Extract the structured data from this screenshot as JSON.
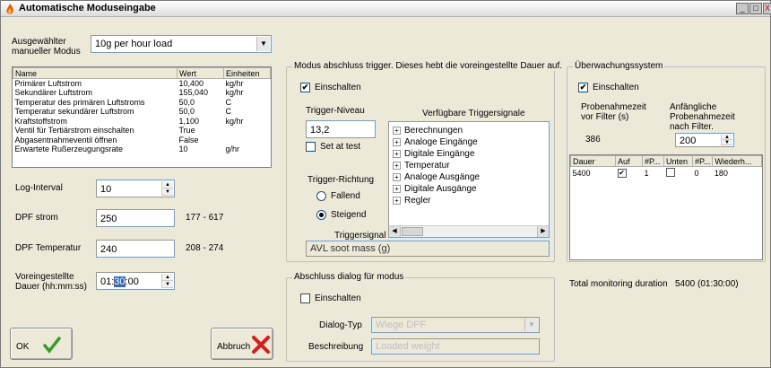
{
  "window": {
    "title": "Automatische Moduseingabe",
    "buttons": [
      "_",
      "□",
      "X"
    ]
  },
  "mode": {
    "label": "Ausgewählter manueller Modus",
    "label_line1": "Ausgewählter",
    "label_line2": "manueller Modus",
    "value": "10g per hour load"
  },
  "param_table": {
    "headers": [
      "Name",
      "Wert",
      "Einheiten"
    ],
    "rows": [
      [
        "Primärer Luftstrom",
        "10,400",
        "kg/hr"
      ],
      [
        "Sekundärer Luftstrom",
        "155,040",
        "kg/hr"
      ],
      [
        "Temperatur des primären Luftstroms",
        "50,0",
        "C"
      ],
      [
        "Temperatur sekundärer Luftstrom",
        "50,0",
        "C"
      ],
      [
        "Kraftstoffstrom",
        "1,100",
        "kg/hr"
      ],
      [
        "Ventil für Tertiärstrom einschalten",
        "True",
        ""
      ],
      [
        "Abgasentnahmeventil öffnen",
        "False",
        ""
      ],
      [
        "Erwartete Rußerzeugungsrate",
        "10",
        "g/hr"
      ]
    ]
  },
  "fields": {
    "log_interval": {
      "label": "Log-Interval",
      "value": "10"
    },
    "dpf_strom": {
      "label": "DPF strom",
      "value": "250",
      "range": "177 - 617"
    },
    "dpf_temp": {
      "label": "DPF Temperatur",
      "value": "240",
      "range": "208 - 274"
    },
    "duration": {
      "label_line1": "Voreingestellte",
      "label_line2": "Dauer (hh:mm:ss)",
      "value_a": "01:",
      "value_sel": "30",
      "value_b": ":00"
    }
  },
  "buttons": {
    "ok": "OK",
    "cancel": "Abbruch"
  },
  "trigger": {
    "group_title": "Modus abschluss trigger. Dieses hebt die voreingestellte Dauer auf.",
    "enable_label": "Einschalten",
    "enable_checked": true,
    "level_label": "Trigger-Niveau",
    "level_value": "13,2",
    "set_at_test_label": "Set at test",
    "direction_label": "Trigger-Richtung",
    "falling_label": "Fallend",
    "rising_label": "Steigend",
    "signals_header": "Verfügbare Triggersignale",
    "signals": [
      "Berechnungen",
      "Analoge Eingänge",
      "Digitale Eingänge",
      "Temperatur",
      "Analoge Ausgänge",
      "Digitale Ausgänge",
      "Regler"
    ],
    "signal_label": "Triggersignal",
    "signal_value": "AVL soot mass (g)"
  },
  "monitoring": {
    "group_title": "Überwachungssystem",
    "enable_label": "Einschalten",
    "enable_checked": true,
    "sample_time_line1": "Probenahmezeit",
    "sample_time_line2": "vor Filter (s)",
    "sample_time_value": "386",
    "initial_line1": "Anfängliche",
    "initial_line2": "Probenahmezeit",
    "initial_line3": "nach Filter.",
    "initial_value": "200",
    "table_headers": [
      "Dauer",
      "Auf",
      "#P...",
      "Unten",
      "#P...",
      "Wiederh..."
    ],
    "table_rows": [
      [
        "5400",
        "✔",
        "1",
        "",
        "0",
        "180"
      ]
    ],
    "total_label": "Total monitoring duration",
    "total_value": "5400 (01:30:00)"
  },
  "closing": {
    "group_title": "Abschluss dialog für modus",
    "enable_label": "Einschalten",
    "dialog_type_label": "Dialog-Typ",
    "dialog_type_value": "Wiege DPF",
    "description_label": "Beschreibung",
    "description_value": "Loaded weight"
  }
}
